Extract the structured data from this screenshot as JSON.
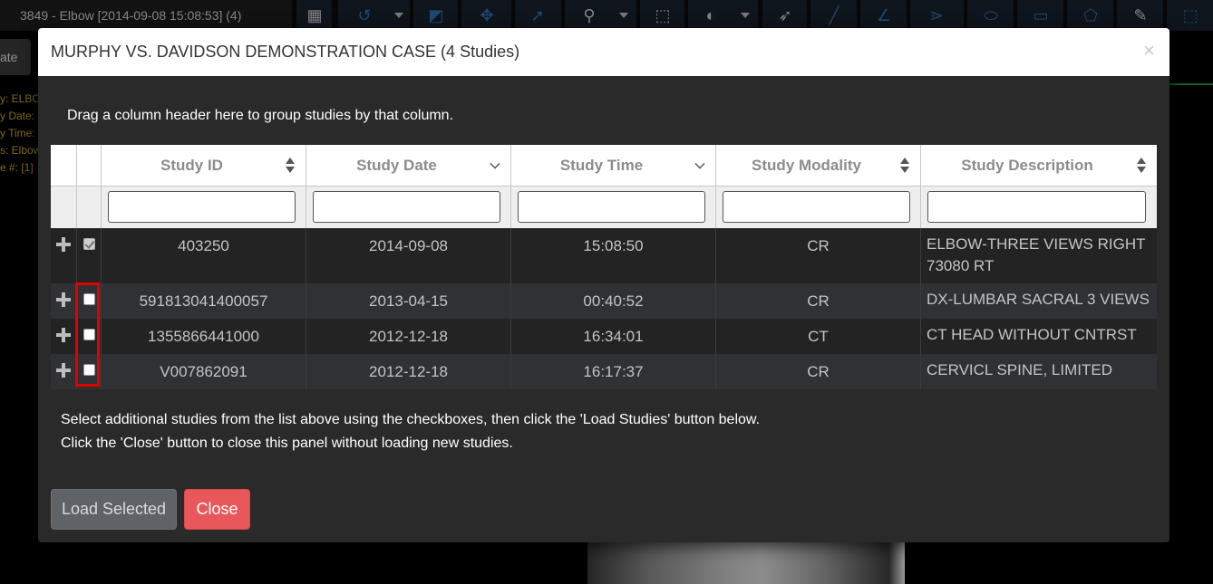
{
  "viewer": {
    "title": "3849 - Elbow [2014-09-08 15:08:53] (4)",
    "side_button_label": "ate",
    "overlay_lines": [
      "y: ELBOW",
      "y Date:",
      "y Time:",
      "s: Elbow",
      "e #: [1]"
    ]
  },
  "modal": {
    "title": "MURPHY VS. DAVIDSON DEMONSTRATION CASE (4 Studies)",
    "close_glyph": "×",
    "group_hint": "Drag a column header here to group studies by that column.",
    "columns": [
      {
        "label": "Study ID",
        "sort": "both"
      },
      {
        "label": "Study Date",
        "sort": "desc"
      },
      {
        "label": "Study Time",
        "sort": "desc"
      },
      {
        "label": "Study Modality",
        "sort": "both"
      },
      {
        "label": "Study Description",
        "sort": "both"
      }
    ],
    "rows": [
      {
        "id": "403250",
        "date": "2014-09-08",
        "time": "15:08:50",
        "modality": "CR",
        "description": "ELBOW-THREE VIEWS RIGHT 73080 RT",
        "checked": true
      },
      {
        "id": "591813041400057",
        "date": "2013-04-15",
        "time": "00:40:52",
        "modality": "CR",
        "description": "DX-LUMBAR SACRAL 3 VIEWS",
        "checked": false
      },
      {
        "id": "1355866441000",
        "date": "2012-12-18",
        "time": "16:34:01",
        "modality": "CT",
        "description": "CT HEAD WITHOUT CNTRST",
        "checked": false
      },
      {
        "id": "V007862091",
        "date": "2012-12-18",
        "time": "16:17:37",
        "modality": "CR",
        "description": "CERVICL SPINE, LIMITED",
        "checked": false
      }
    ],
    "instructions": [
      "Select additional studies from the list above using the checkboxes, then click the 'Load Studies' button below.",
      "Click the 'Close' button to close this panel without loading new studies."
    ],
    "load_button": "Load Selected",
    "close_button": "Close"
  },
  "colors": {
    "header_bg": "#ffffff",
    "row_odd": "#232323",
    "row_even": "#2f3134",
    "close_button": "#e8575a",
    "load_button": "#5f6368",
    "highlight": "#e00000"
  }
}
